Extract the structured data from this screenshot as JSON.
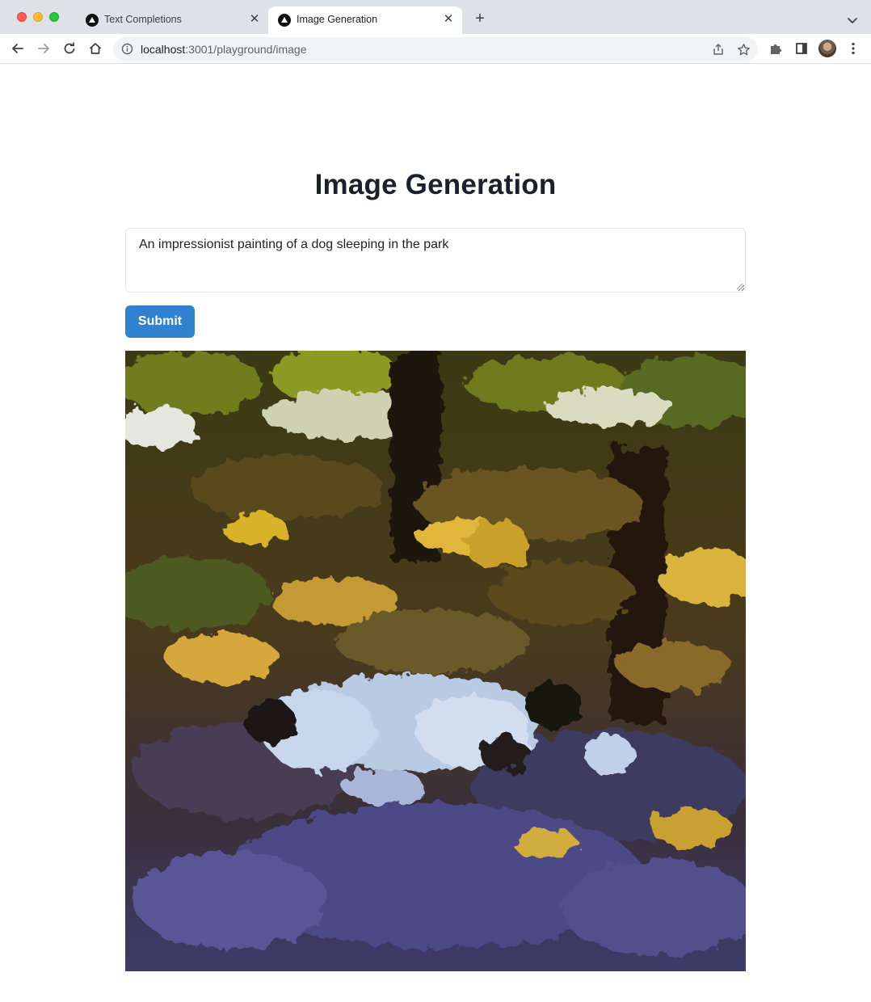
{
  "browser": {
    "tabs": [
      {
        "label": "Text Completions",
        "active": false
      },
      {
        "label": "Image Generation",
        "active": true
      }
    ],
    "address": {
      "host": "localhost",
      "path": ":3001/playground/image"
    }
  },
  "page": {
    "title": "Image Generation",
    "prompt_value": "An impressionist painting of a dog sleeping in the park",
    "submit_label": "Submit"
  },
  "icons": {
    "back": "arrow-left-icon",
    "forward": "arrow-right-icon",
    "reload": "reload-icon",
    "home": "home-icon",
    "info": "info-icon",
    "share": "share-icon",
    "bookmark": "star-icon",
    "extensions": "puzzle-icon",
    "side_panel": "side-panel-icon",
    "menu": "kebab-menu-icon"
  },
  "colors": {
    "accent": "#3182ce",
    "heading": "#1a202c"
  }
}
